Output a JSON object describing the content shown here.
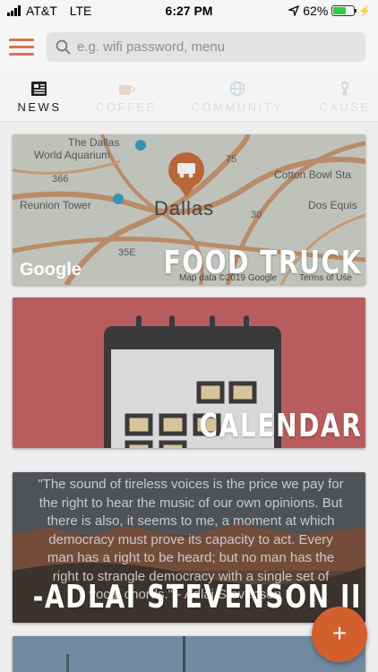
{
  "status_bar": {
    "carrier": "AT&T",
    "network": "LTE",
    "time": "6:27 PM",
    "battery": "62%",
    "battery_level": 0.62
  },
  "header": {
    "menu_icon": "hamburger-icon",
    "search": {
      "icon": "search-icon",
      "placeholder": "e.g. wifi password, menu",
      "value": ""
    }
  },
  "tabs": [
    {
      "label": "NEWS",
      "icon": "newspaper-icon",
      "active": true
    },
    {
      "label": "COFFEE",
      "icon": "coffee-cup-icon",
      "active": false
    },
    {
      "label": "COMMUNITY",
      "icon": "globe-icon",
      "active": false
    },
    {
      "label": "CAUSE",
      "icon": "ribbon-icon",
      "active": false
    }
  ],
  "cards": {
    "food_truck": {
      "title": "FOOD TRUCK",
      "map": {
        "city": "Dallas",
        "labels": [
          "The Dallas",
          "World Aquarium",
          "Reunion Tower",
          "Cotton Bowl Sta",
          "Dos Equis",
          "75",
          "366",
          "30",
          "35E"
        ],
        "attribution": "Map data ©2019 Google",
        "terms": "Terms of Use",
        "logo": "Google"
      }
    },
    "calendar": {
      "title": "CALENDAR",
      "icon": "calendar-icon"
    },
    "quote": {
      "title": "-ADLAI STEVENSON II",
      "text": "\"The sound of tireless voices is the price we pay for the right to hear the music of our own opinions. But there is also, it seems to me, a moment at which democracy must prove its capacity to act. Every man has a right to be heard; but no man has the right to strangle democracy with a single set of vocal chords.\" - Adlai Stevenson II"
    }
  },
  "fab": {
    "label": "+"
  },
  "colors": {
    "accent": "#d35f2f",
    "calendar_bg": "#b85d5d"
  }
}
